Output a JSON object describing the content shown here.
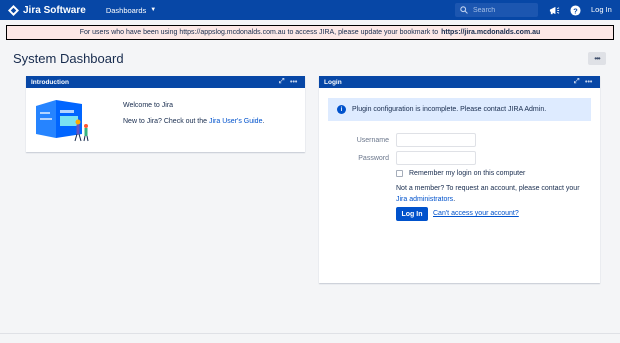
{
  "nav": {
    "product": "Jira Software",
    "dashboards": "Dashboards",
    "search_placeholder": "Search",
    "login": "Log In"
  },
  "banner": {
    "message": "For users who have been using https://appslog.mcdonalds.com.au to access JIRA, please update your bookmark to",
    "url": "https://jira.mcdonalds.com.au"
  },
  "page": {
    "title": "System Dashboard",
    "more": "•••"
  },
  "intro": {
    "title": "Introduction",
    "welcome": "Welcome to Jira",
    "line_prefix": "New to Jira? Check out the",
    "link": "Jira User's Guide",
    "line_suffix": "."
  },
  "login": {
    "title": "Login",
    "info": "Plugin configuration is incomplete. Please contact JIRA Admin.",
    "username_label": "Username",
    "password_label": "Password",
    "remember": "Remember my login on this computer",
    "member_text": "Not a member? To request an account, please contact your",
    "admins_link": "Jira administrators",
    "member_suffix": ".",
    "button": "Log In",
    "cant_access": "Can't access your account?"
  },
  "gadget_controls": {
    "expand": "⤢",
    "menu": "•••"
  },
  "colors": {
    "nav": "#0747a6",
    "banner": "#fce8e6",
    "info": "#deebff",
    "link": "#0052cc"
  }
}
